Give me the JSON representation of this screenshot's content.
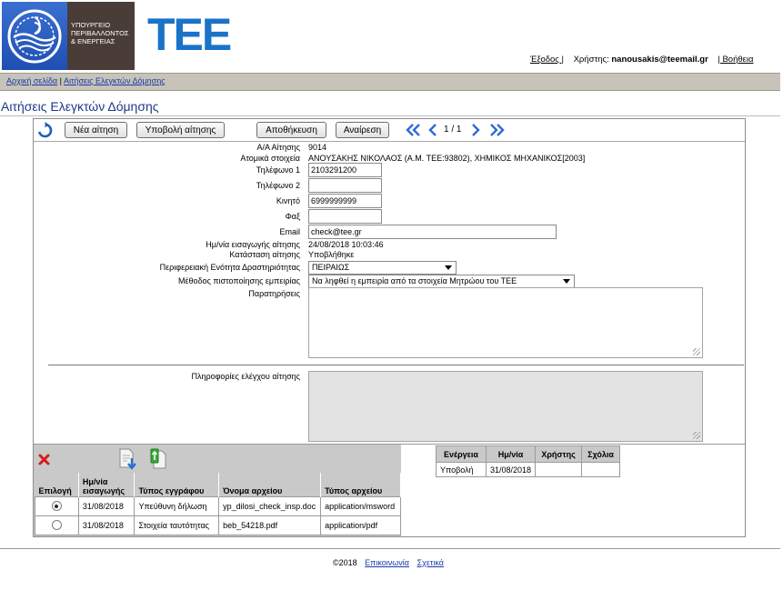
{
  "header": {
    "ministry_lines": [
      "ΥΠΟΥΡΓΕΙΟ",
      "ΠΕΡΙΒΑΛΛΟΝΤΟΣ",
      "& ΕΝΕΡΓΕΙΑΣ"
    ],
    "tee_logo": "ΤΕΕ",
    "logout_label": "Έξοδος |",
    "user_prefix": "Χρήστης:",
    "user_email": "nanousakis@teemail.gr",
    "help_label": "| Βοήθεια"
  },
  "breadcrumb": {
    "home": "Αρχική σελίδα",
    "separator": "|",
    "current": "Αιτήσεις Ελεγκτών Δόμησης"
  },
  "page_title": "Αιτήσεις Ελεγκτών Δόμησης",
  "toolbar": {
    "refresh_icon": "refresh-icon",
    "new_label": "Νέα αίτηση",
    "submit_label": "Υποβολή αίτησης",
    "save_label": "Αποθήκευση",
    "cancel_label": "Αναίρεση",
    "pager": "1 / 1"
  },
  "form": {
    "aa_label": "Α/Α Αίτησης",
    "aa_value": "9014",
    "personal_label": "Ατομικά στοιχεία",
    "personal_value": "ΑΝΟΥΣΑΚΗΣ ΝΙΚΟΛΑΟΣ (Α.Μ. ΤΕΕ:93802), ΧΗΜΙΚΟΣ ΜΗΧΑΝΙΚΟΣ[2003]",
    "phone1_label": "Τηλέφωνο 1",
    "phone1_value": "2103291200",
    "phone2_label": "Τηλέφωνο 2",
    "phone2_value": "",
    "mobile_label": "Κινητό",
    "mobile_value": "6999999999",
    "fax_label": "Φαξ",
    "fax_value": "",
    "email_label": "Email",
    "email_value": "check@tee.gr",
    "entry_date_label": "Ημ/νία εισαγωγής αίτησης",
    "entry_date_value": "24/08/2018 10:03:46",
    "status_label": "Κατάσταση αίτησης",
    "status_value": "Υποβλήθηκε",
    "region_label": "Περιφερειακή Ενότητα Δραστηριότητας",
    "region_value": "ΠΕΙΡΑΙΩΣ",
    "method_label": "Μέθοδος πιστοποίησης εμπειρίας",
    "method_value": "Να ληφθεί η εμπειρία από τα στοιχεία Μητρώου του ΤΕΕ",
    "notes_label": "Παρατηρήσεις",
    "check_info_label": "Πληροφορίες ελέγχου αίτησης"
  },
  "documents": {
    "delete_icon": "delete-icon",
    "download_icon": "download-icon",
    "upload_icon": "upload-icon",
    "headers": [
      "Επιλογή",
      "Ημ/νία εισαγωγής",
      "Τύπος εγγράφου",
      "Όνομα αρχείου",
      "Τύπος αρχείου"
    ],
    "rows": [
      {
        "selected": true,
        "date": "31/08/2018",
        "doc_type": "Υπεύθυνη δήλωση",
        "file_name": "yp_dilosi_check_insp.doc",
        "file_type": "application/msword"
      },
      {
        "selected": false,
        "date": "31/08/2018",
        "doc_type": "Στοιχεία ταυτότητας",
        "file_name": "beb_54218.pdf",
        "file_type": "application/pdf"
      }
    ]
  },
  "history": {
    "headers": [
      "Ενέργεια",
      "Ημ/νία",
      "Χρήστης",
      "Σχόλια"
    ],
    "rows": [
      {
        "action": "Υποβολή",
        "date": "31/08/2018",
        "user": "",
        "comments": ""
      }
    ]
  },
  "footer": {
    "copyright": "©2018",
    "contact": "Επικοινωνία",
    "about": "Σχετικά"
  },
  "colors": {
    "accent": "#1a73c9",
    "title": "#1d3a8a",
    "link": "#1c3aa8",
    "crumb_bar": "#c7c3b8",
    "table_header": "#c9c9c9"
  }
}
